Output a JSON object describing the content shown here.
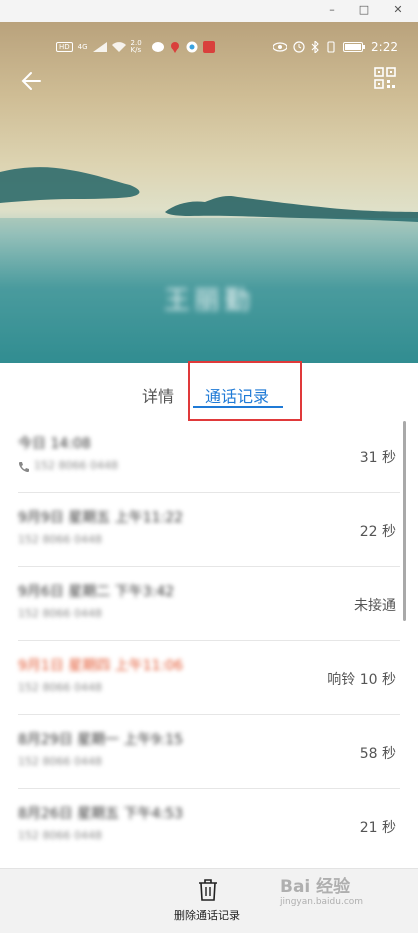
{
  "window": {
    "minimize": "–",
    "maximize": "□",
    "close": "✕"
  },
  "status_bar": {
    "left": [
      "HD",
      "4G",
      "2.0 K/s"
    ],
    "time": "2:22"
  },
  "contact": {
    "name": "王丽勤"
  },
  "tabs": [
    {
      "label": "详情",
      "active": false
    },
    {
      "label": "通话记录",
      "active": true
    }
  ],
  "calls": [
    {
      "title": "今日 14:08",
      "subtitle": "152 8066 0448",
      "duration": "31 秒",
      "missed": false,
      "icon": true
    },
    {
      "title": "9月9日 星期五 上午11:22",
      "subtitle": "152 8066 0448",
      "duration": "22 秒",
      "missed": false,
      "icon": false
    },
    {
      "title": "9月6日 星期二 下午3:42",
      "subtitle": "152 8066 0448",
      "duration": "未接通",
      "missed": false,
      "icon": false
    },
    {
      "title": "9月1日 星期四 上午11:06",
      "subtitle": "152 8066 0448",
      "duration": "响铃 10 秒",
      "missed": true,
      "icon": false
    },
    {
      "title": "8月29日 星期一 上午9:15",
      "subtitle": "152 8066 0448",
      "duration": "58 秒",
      "missed": false,
      "icon": false
    },
    {
      "title": "8月26日 星期五 下午4:53",
      "subtitle": "152 8066 0448",
      "duration": "21 秒",
      "missed": false,
      "icon": false
    }
  ],
  "bottom": {
    "delete_label": "删除通话记录"
  },
  "watermark": {
    "text": "Bai 经验",
    "sub": "jingyan.baidu.com"
  },
  "colors": {
    "accent": "#1f7ad6",
    "highlight": "#e0393a",
    "missed": "#e2532c"
  }
}
